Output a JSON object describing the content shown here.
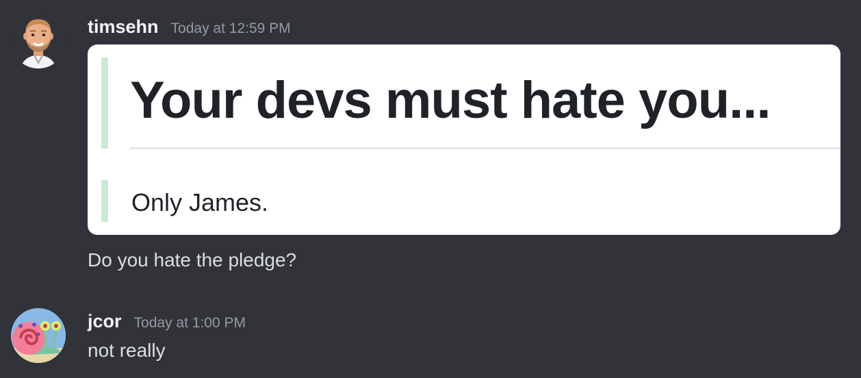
{
  "messages": [
    {
      "username": "timsehn",
      "timestamp": "Today at 12:59 PM",
      "image": {
        "heading": "Your devs must hate you...",
        "body": "Only James."
      },
      "text": "Do you hate the pledge?"
    },
    {
      "username": "jcor",
      "timestamp": "Today at 1:00 PM",
      "text": "not really"
    }
  ],
  "colors": {
    "background": "#313338",
    "username": "#f2f3f5",
    "timestamp": "#949ba4",
    "message_text": "#dbdee1",
    "quote_bar": "#c8ead2"
  },
  "icons": {
    "avatar_1": "bitmoji-avatar",
    "avatar_2": "snail-avatar"
  }
}
